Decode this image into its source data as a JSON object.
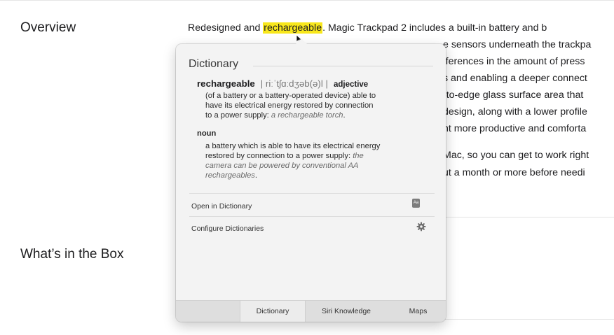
{
  "sections": {
    "overview_heading": "Overview",
    "whats_in_box_heading": "What’s in the Box"
  },
  "article": {
    "line1_before": "Redesigned and ",
    "line1_highlight": "rechargeable",
    "line1_after": ". Magic Trackpad 2 includes a built-in battery and b",
    "line2": "e sensors underneath the trackpa",
    "line3": "fferences in the amount of press",
    "line4": "s and enabling a deeper connect",
    "line5": "-to-edge glass surface area that",
    "line6": "design, along with a lower profile",
    "line7": "nt more productive and comforta",
    "line8": "Mac, so you can get to work right",
    "line9": "ut a month or more before needi"
  },
  "popover": {
    "title": "Dictionary",
    "headword": "rechargeable",
    "pronunciation": "| riːˈtʃɑːdʒəb(ə)l |",
    "pos_adjective": "adjective",
    "adj_def_1": "(of a battery or a battery-operated device) able to",
    "adj_def_2": "have its electrical energy restored by connection",
    "adj_def_3": "to a power supply: ",
    "adj_example": "a rechargeable torch",
    "adj_period": ".",
    "pos_noun": "noun",
    "noun_def_1": "a battery which is able to have its electrical energy",
    "noun_def_2": "restored by connection to a power supply: ",
    "noun_example_1": "the",
    "noun_example_2": "camera can be powered by conventional AA",
    "noun_example_3": "rechargeables",
    "noun_period": ".",
    "open_in_dictionary": "Open in Dictionary",
    "configure_dictionaries": "Configure Dictionaries",
    "dict_icon_text": "Aa",
    "tabs": [
      "Dictionary",
      "Siri Knowledge",
      "Maps"
    ]
  },
  "colors": {
    "highlight": "#f8e71c",
    "popover_bg": "#f3f3f3",
    "tab_bar": "#dedede"
  },
  "icons": [
    "pointer-cursor-icon",
    "dictionary-app-icon",
    "gear-icon"
  ]
}
